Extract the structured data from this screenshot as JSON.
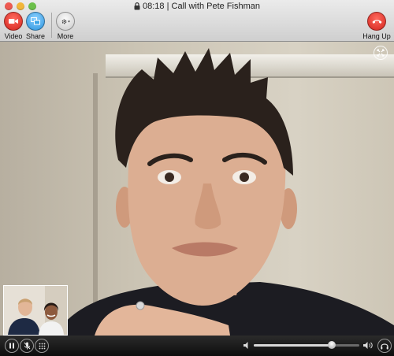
{
  "window": {
    "time": "08:18",
    "separator": "|",
    "call_title": "Call with Pete Fishman"
  },
  "toolbar": {
    "video_label": "Video",
    "share_label": "Share",
    "more_label": "More",
    "hangup_label": "Hang Up"
  },
  "controls": {
    "volume_level": 0.74
  },
  "colors": {
    "red_button": "#e2372c",
    "share_button": "#3aa3e6",
    "toolbar": "#dcdcdc",
    "controlbar": "#1a1a1a"
  },
  "icons": [
    "lock-icon",
    "video-camera-icon",
    "screen-share-icon",
    "gear-icon",
    "phone-hangup-icon",
    "fullscreen-icon",
    "pause-icon",
    "mute-mic-icon",
    "keypad-icon",
    "volume-low-icon",
    "volume-high-icon",
    "headset-icon"
  ]
}
